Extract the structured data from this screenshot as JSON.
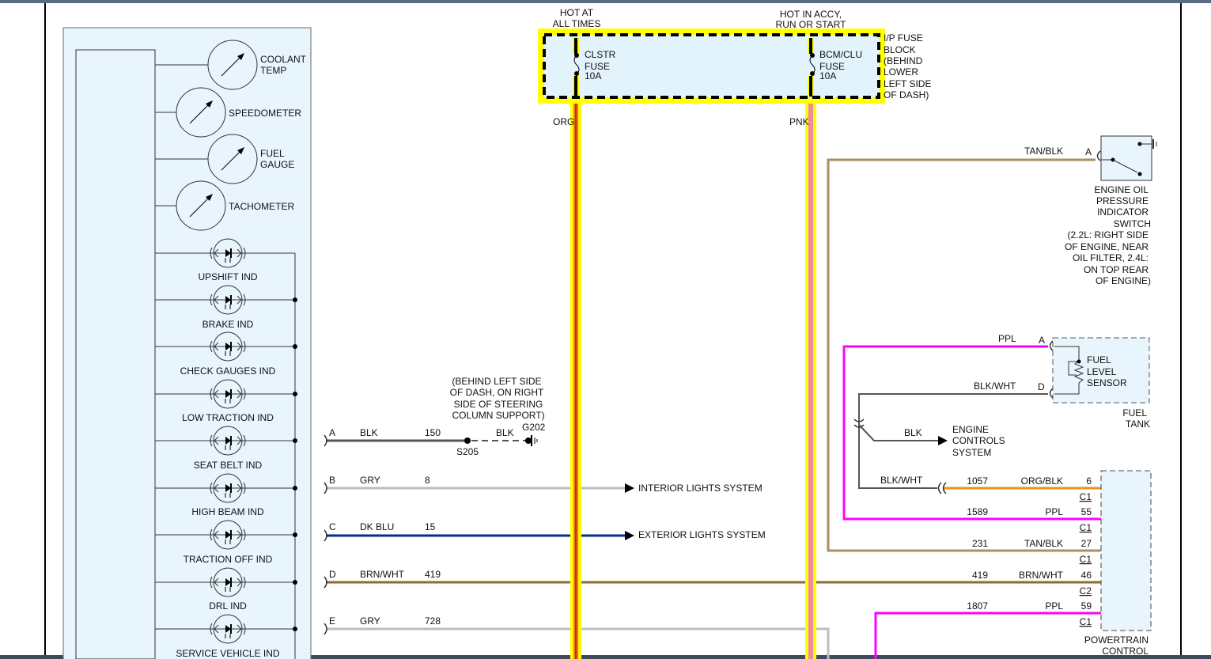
{
  "fuse_block": {
    "hot_at_all_times": [
      "HOT AT",
      "ALL TIMES"
    ],
    "hot_in_accy": [
      "HOT IN ACCY,",
      "RUN OR START"
    ],
    "label": [
      "I/P FUSE",
      "BLOCK",
      "(BEHIND",
      "LOWER",
      "LEFT SIDE",
      "OF DASH)"
    ],
    "fuse1": [
      "CLSTR",
      "FUSE",
      "10A"
    ],
    "fuse2": [
      "BCM/CLU",
      "FUSE",
      "10A"
    ],
    "wire1_color": "ORG",
    "wire2_color": "PNK"
  },
  "cluster": {
    "gauges": [
      [
        "COOLANT",
        "TEMP"
      ],
      [
        "SPEEDOMETER"
      ],
      [
        "FUEL",
        "GAUGE"
      ],
      [
        "TACHOMETER"
      ]
    ],
    "indicators": [
      "UPSHIFT IND",
      "BRAKE IND",
      "CHECK GAUGES IND",
      "LOW TRACTION IND",
      "SEAT BELT IND",
      "HIGH BEAM IND",
      "TRACTION OFF IND",
      "DRL IND",
      "SERVICE VEHICLE IND"
    ]
  },
  "left_wires": [
    {
      "pin": "A",
      "color": "BLK",
      "circuit": "150"
    },
    {
      "pin": "B",
      "color": "GRY",
      "circuit": "8"
    },
    {
      "pin": "C",
      "color": "DK BLU",
      "circuit": "15"
    },
    {
      "pin": "D",
      "color": "BRN/WHT",
      "circuit": "419"
    },
    {
      "pin": "E",
      "color": "GRY",
      "circuit": "728"
    }
  ],
  "ground": {
    "location": [
      "(BEHIND LEFT SIDE",
      "OF DASH, ON RIGHT",
      "SIDE OF STEERING",
      "COLUMN SUPPORT)"
    ],
    "splice": "S205",
    "ground_id": "G202",
    "color": "BLK"
  },
  "destinations": {
    "interior": "INTERIOR LIGHTS SYSTEM",
    "exterior": "EXTERIOR LIGHTS SYSTEM",
    "engine_controls": [
      "ENGINE",
      "CONTROLS",
      "SYSTEM"
    ],
    "engine_controls_wire": "BLK"
  },
  "oil_switch": {
    "wire": "TAN/BLK",
    "pin": "A",
    "label": [
      "ENGINE OIL",
      "PRESSURE",
      "INDICATOR",
      "SWITCH",
      "(2.2L: RIGHT SIDE",
      "OF ENGINE, NEAR",
      "OIL FILTER, 2.4L:",
      "ON TOP REAR",
      "OF ENGINE)"
    ]
  },
  "fuel_sensor": {
    "pin_a": "A",
    "wire_a": "PPL",
    "pin_d": "D",
    "wire_d": "BLK/WHT",
    "label": [
      "FUEL",
      "LEVEL",
      "SENSOR"
    ],
    "location": [
      "FUEL",
      "TANK"
    ]
  },
  "pcm": {
    "label": [
      "POWERTRAIN",
      "CONTROL"
    ],
    "splice_wire": "BLK/WHT",
    "pins": [
      {
        "circuit": "1057",
        "color": "ORG/BLK",
        "pin": "6",
        "conn": "C1"
      },
      {
        "circuit": "1589",
        "color": "PPL",
        "pin": "55",
        "conn": "C1"
      },
      {
        "circuit": "231",
        "color": "TAN/BLK",
        "pin": "27",
        "conn": "C1"
      },
      {
        "circuit": "419",
        "color": "BRN/WHT",
        "pin": "46",
        "conn": "C2"
      },
      {
        "circuit": "1807",
        "color": "PPL",
        "pin": "59",
        "conn": "C1"
      }
    ]
  },
  "colors": {
    "yellow_highlight": "#ffff00",
    "org": "#f07a10",
    "pnk": "#f08aa0",
    "ppl": "#ff00ff",
    "tan": "#a89060",
    "brn": "#8c6a30",
    "dkblu": "#0a2a8a",
    "gry": "#bdbdbd",
    "panel": "#e8f5fd"
  }
}
